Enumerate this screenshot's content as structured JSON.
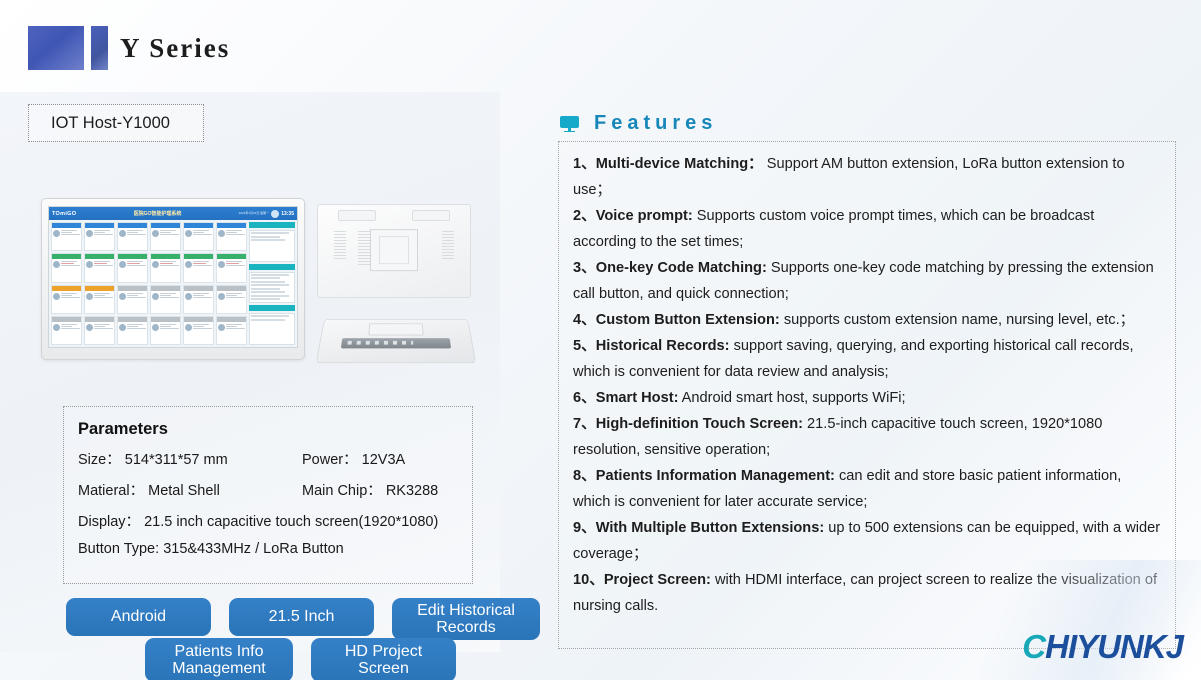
{
  "header": {
    "series_title": "Y Series",
    "logo_color_primary": "#4356b5"
  },
  "product": {
    "label": "IOT Host-Y1000",
    "screen_ui": {
      "brand": "TOmiGO",
      "title": "医院GO智能护理系统",
      "date": "2023年1月23日 星期一",
      "time": "13:35"
    }
  },
  "parameters": {
    "heading": "Parameters",
    "rows": [
      {
        "left_label": "Size：",
        "left_value": "514*311*57 mm",
        "right_label": "Power：",
        "right_value": "12V3A"
      },
      {
        "left_label": "Matieral：",
        "left_value": "Metal Shell",
        "right_label": "Main Chip：",
        "right_value": "RK3288"
      }
    ],
    "display_label": "Display：",
    "display_value": "21.5 inch capacitive touch screen(1920*1080)",
    "button_type_label": "Button Type:",
    "button_type_value": "315&433MHz / LoRa Button"
  },
  "tags": {
    "row1": [
      "Android",
      "21.5 Inch",
      "Edit Historical Records"
    ],
    "row2": [
      "Patients Info Management",
      "HD Project Screen"
    ],
    "color": "#2f7bc0"
  },
  "features": {
    "title": "Features",
    "icon": "monitor-icon",
    "accent_color": "#1787ba",
    "items": [
      {
        "num": "1、",
        "title": "Multi-device Matching：",
        "text": " Support AM button extension, LoRa button extension to use；"
      },
      {
        "num": "2、",
        "title": "Voice prompt:",
        "text": " Supports custom voice prompt times, which can be broadcast according to the set times;"
      },
      {
        "num": "3、",
        "title": "One-key Code Matching:",
        "text": " Supports one-key code matching by pressing the extension call button, and quick connection;"
      },
      {
        "num": "4、",
        "title": "Custom Button Extension:",
        "text": " supports custom extension name, nursing level, etc.；"
      },
      {
        "num": "5、",
        "title": "Historical Records:",
        "text": " support saving, querying, and exporting historical call records, which is convenient for data review and analysis;"
      },
      {
        "num": "6、",
        "title": "Smart Host:",
        "text": " Android smart host, supports WiFi;"
      },
      {
        "num": "7、",
        "title": "High-definition Touch Screen:",
        "text": " 21.5-inch capacitive touch screen, 1920*1080 resolution, sensitive operation;"
      },
      {
        "num": "8、",
        "title": "Patients Information Management:",
        "text": " can edit and store basic patient information, which is convenient for later accurate service;"
      },
      {
        "num": "9、",
        "title": "With Multiple Button Extensions:",
        "text": " up to 500 extensions can be equipped, with a wider coverage；"
      },
      {
        "num": "10、",
        "title": "Project Screen:",
        "text": " with HDMI interface, can project screen to realize the visualization of nursing calls."
      }
    ]
  },
  "brand": {
    "first_letter": "C",
    "rest": "HIYUNKJ",
    "color_accent": "#18a8b8",
    "color_main": "#1b4f9c"
  }
}
